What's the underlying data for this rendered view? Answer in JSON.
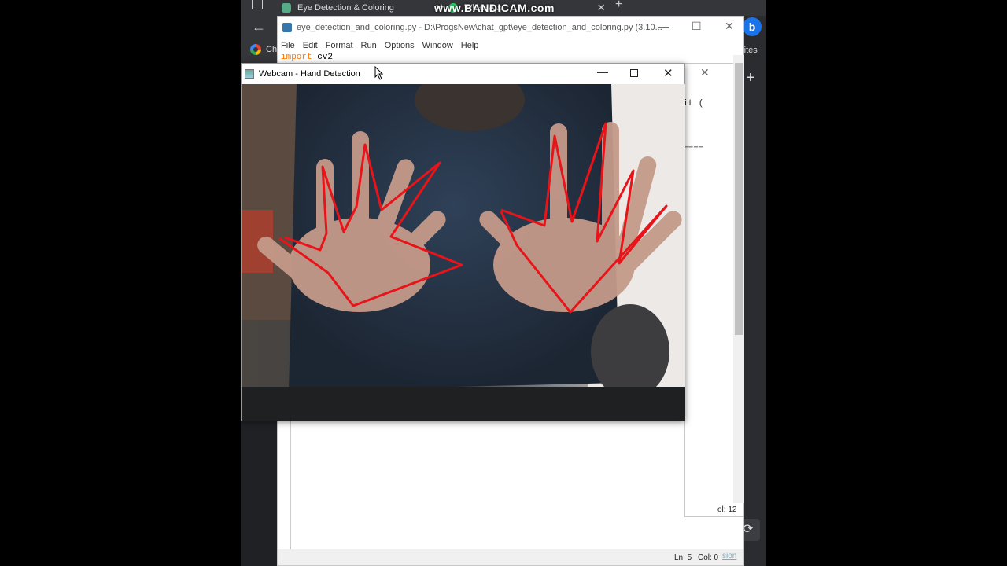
{
  "browser": {
    "tabs": [
      {
        "label": "Eye Detection & Coloring"
      },
      {
        "label": "WhatsApp"
      }
    ],
    "watermark": "www.BANDICAM.com",
    "bookmark_label": "Ch",
    "side_favorites": "rites",
    "bing_letter": "b"
  },
  "editor": {
    "title": "eye_detection_and_coloring.py - D:\\ProgsNew\\chat_gpt\\eye_detection_and_coloring.py (3.10...",
    "menu": [
      "File",
      "Edit",
      "Format",
      "Run",
      "Options",
      "Window",
      "Help"
    ],
    "code_keyword": "import",
    "code_rest": " cv2",
    "status_ln": "Ln: 5",
    "status_col": "Col: 0"
  },
  "shell": {
    "text1": "it (",
    "text2": "====",
    "status": "ol: 12",
    "status_link": "sion"
  },
  "webcam": {
    "title": "Webcam - Hand Detection"
  },
  "colors": {
    "outline": "#e8141a",
    "shirt": "#2b3a4e",
    "skin": "#c89c8c"
  }
}
